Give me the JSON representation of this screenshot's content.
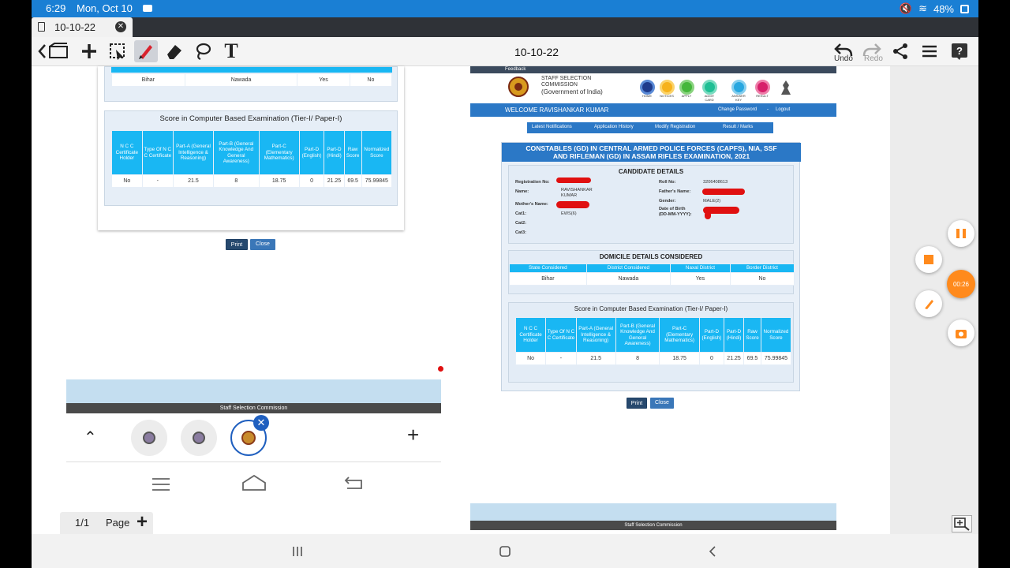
{
  "status": {
    "time": "6:29",
    "date": "Mon, Oct 10",
    "battery": "48%"
  },
  "tab": {
    "title": "10-10-22",
    "close": "✕"
  },
  "toolbar": {
    "doc_title": "10-10-22",
    "undo": "Undo",
    "redo": "Redo"
  },
  "left": {
    "domicile_row": [
      "Bihar",
      "Nawada",
      "Yes",
      "No"
    ],
    "score_title": "Score in Computer Based Examination (Tier-I/ Paper-I)",
    "score_headers": [
      "N C C Certificate Holder",
      "Type Of N C C Certificate",
      "Part-A (General Intelligence & Reasoning)",
      "Part-B (General Knowledge And General Awareness)",
      "Part-C (Elementary Mathematics)",
      "Part-D (English)",
      "Part-D (Hindi)",
      "Raw Score",
      "Normalized Score"
    ],
    "score_row": [
      "No",
      "-",
      "21.5",
      "8",
      "18.75",
      "0",
      "21.25",
      "69.5",
      "75.99845"
    ],
    "print": "Print",
    "close": "Close"
  },
  "browser": {
    "footer": "Staff Selection Commission",
    "plus": "+"
  },
  "right": {
    "feedback": "Feedback",
    "org_line1": "STAFF SELECTION",
    "org_line2": "COMMISSION",
    "org_line3": "(Government of India)",
    "nav": [
      "HOME",
      "NOTICES",
      "APPLY",
      "ADMIT CARD",
      "ANSWER KEY",
      "RESULT"
    ],
    "welcome": "WELCOME RAVISHANKAR KUMAR",
    "change_password": "Change Password",
    "logout": "Logout",
    "menu": [
      "Latest Notifications",
      "Application History",
      "Modify Registration",
      "Result / Marks"
    ],
    "exam_title_1": "CONSTABLES (GD) IN CENTRAL ARMED POLICE FORCES (CAPFS), NIA, SSF",
    "exam_title_2": "AND RIFLEMAN (GD) IN ASSAM RIFLES EXAMINATION, 2021",
    "candidate_title": "CANDIDATE DETAILS",
    "reg_label": "Registration No:",
    "roll_label": "Roll No:",
    "roll_value": "3206408613",
    "name_label": "Name:",
    "name_value_1": "RAVISHANKAR",
    "name_value_2": "KUMAR",
    "father_label": "Father's Name:",
    "gender_label": "Gender:",
    "gender_value": "MALE(2)",
    "mother_label": "Mother's Name:",
    "dob_label_1": "Date of Birth",
    "dob_label_2": "(DD-MM-YYYY):",
    "cat1_label": "Cat1:",
    "cat1_value": "EWS(6)",
    "cat2_label": "Cat2:",
    "cat3_label": "Cat3:",
    "domicile_title": "DOMICILE DETAILS CONSIDERED",
    "domicile_headers": [
      "State Considered",
      "District Considered",
      "Naxal District",
      "Border District"
    ],
    "domicile_row": [
      "Bihar",
      "Nawada",
      "Yes",
      "No"
    ],
    "score_title": "Score in Computer Based Examination (Tier-I/ Paper-I)",
    "print": "Print",
    "close": "Close",
    "footer": "Staff Selection Commission"
  },
  "floating": {
    "timer": "00:26"
  },
  "pagebar": {
    "count": "1/1",
    "label": "Page",
    "add": "+"
  }
}
